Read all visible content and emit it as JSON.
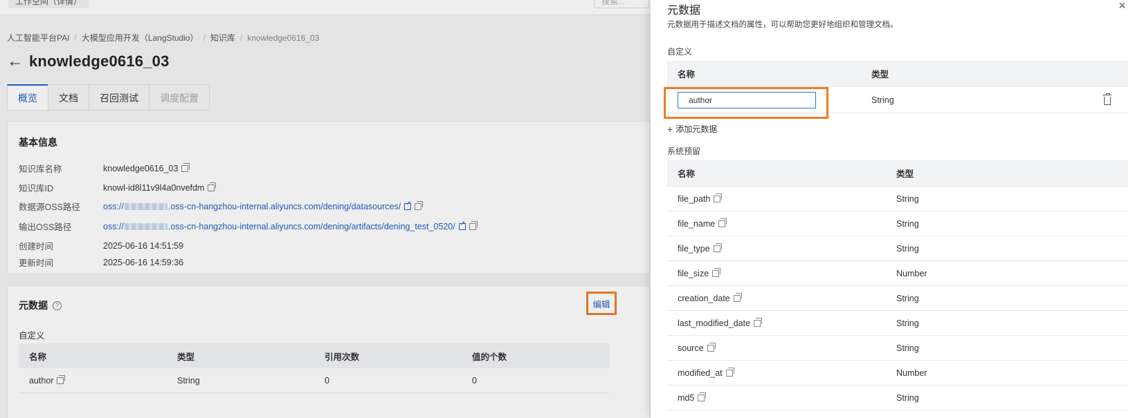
{
  "topbar": {
    "workspace": "工作空间（详情）",
    "search_placeholder": "搜索..."
  },
  "breadcrumb": [
    "人工智能平台PAI",
    "大模型应用开发（LangStudio）",
    "知识库",
    "knowledge0616_03"
  ],
  "page_title": "knowledge0616_03",
  "tabs": [
    {
      "label": "概览",
      "state": "active"
    },
    {
      "label": "文档",
      "state": "normal"
    },
    {
      "label": "召回测试",
      "state": "normal"
    },
    {
      "label": "调度配置",
      "state": "disabled"
    }
  ],
  "basic_info": {
    "title": "基本信息",
    "rows": [
      {
        "key": "知识库名称",
        "value": "knowledge0616_03"
      },
      {
        "key": "知识库ID",
        "value": "knowl-id8l11v9l4a0nvefdm"
      },
      {
        "key": "数据源OSS路径",
        "value_prefix": "oss://",
        "value_suffix": ".oss-cn-hangzhou-internal.aliyuncs.com/dening/datasources/"
      },
      {
        "key": "输出OSS路径",
        "value_prefix": "oss://",
        "value_suffix": ".oss-cn-hangzhou-internal.aliyuncs.com/dening/artifacts/dening_test_0520/"
      },
      {
        "key": "创建时间",
        "value": "2025-06-16 14:51:59"
      },
      {
        "key": "更新时间",
        "value": "2025-06-16 14:59:36"
      }
    ]
  },
  "metadata_card": {
    "title": "元数据",
    "edit_label": "编辑",
    "subtitle": "自定义",
    "columns": [
      "名称",
      "类型",
      "引用次数",
      "值的个数"
    ],
    "rows": [
      {
        "name": "author",
        "type": "String",
        "refs": "0",
        "values": "0"
      }
    ]
  },
  "drawer": {
    "title": "元数据",
    "description": "元数据用于描述文档的属性，可以帮助您更好地组织和管理文档。",
    "close_glyph": "×",
    "custom_label": "自定义",
    "custom_columns": [
      "名称",
      "类型"
    ],
    "custom_rows": [
      {
        "name": "author",
        "type": "String"
      }
    ],
    "add_label": "添加元数据",
    "system_label": "系统预留",
    "system_columns": [
      "名称",
      "类型"
    ],
    "system_rows": [
      {
        "name": "file_path",
        "type": "String"
      },
      {
        "name": "file_name",
        "type": "String"
      },
      {
        "name": "file_type",
        "type": "String"
      },
      {
        "name": "file_size",
        "type": "Number"
      },
      {
        "name": "creation_date",
        "type": "String"
      },
      {
        "name": "last_modified_date",
        "type": "String"
      },
      {
        "name": "source",
        "type": "String"
      },
      {
        "name": "modified_at",
        "type": "Number"
      },
      {
        "name": "md5",
        "type": "String"
      }
    ]
  },
  "colors": {
    "accent": "#1f5fbf",
    "highlight": "#f07c22"
  }
}
